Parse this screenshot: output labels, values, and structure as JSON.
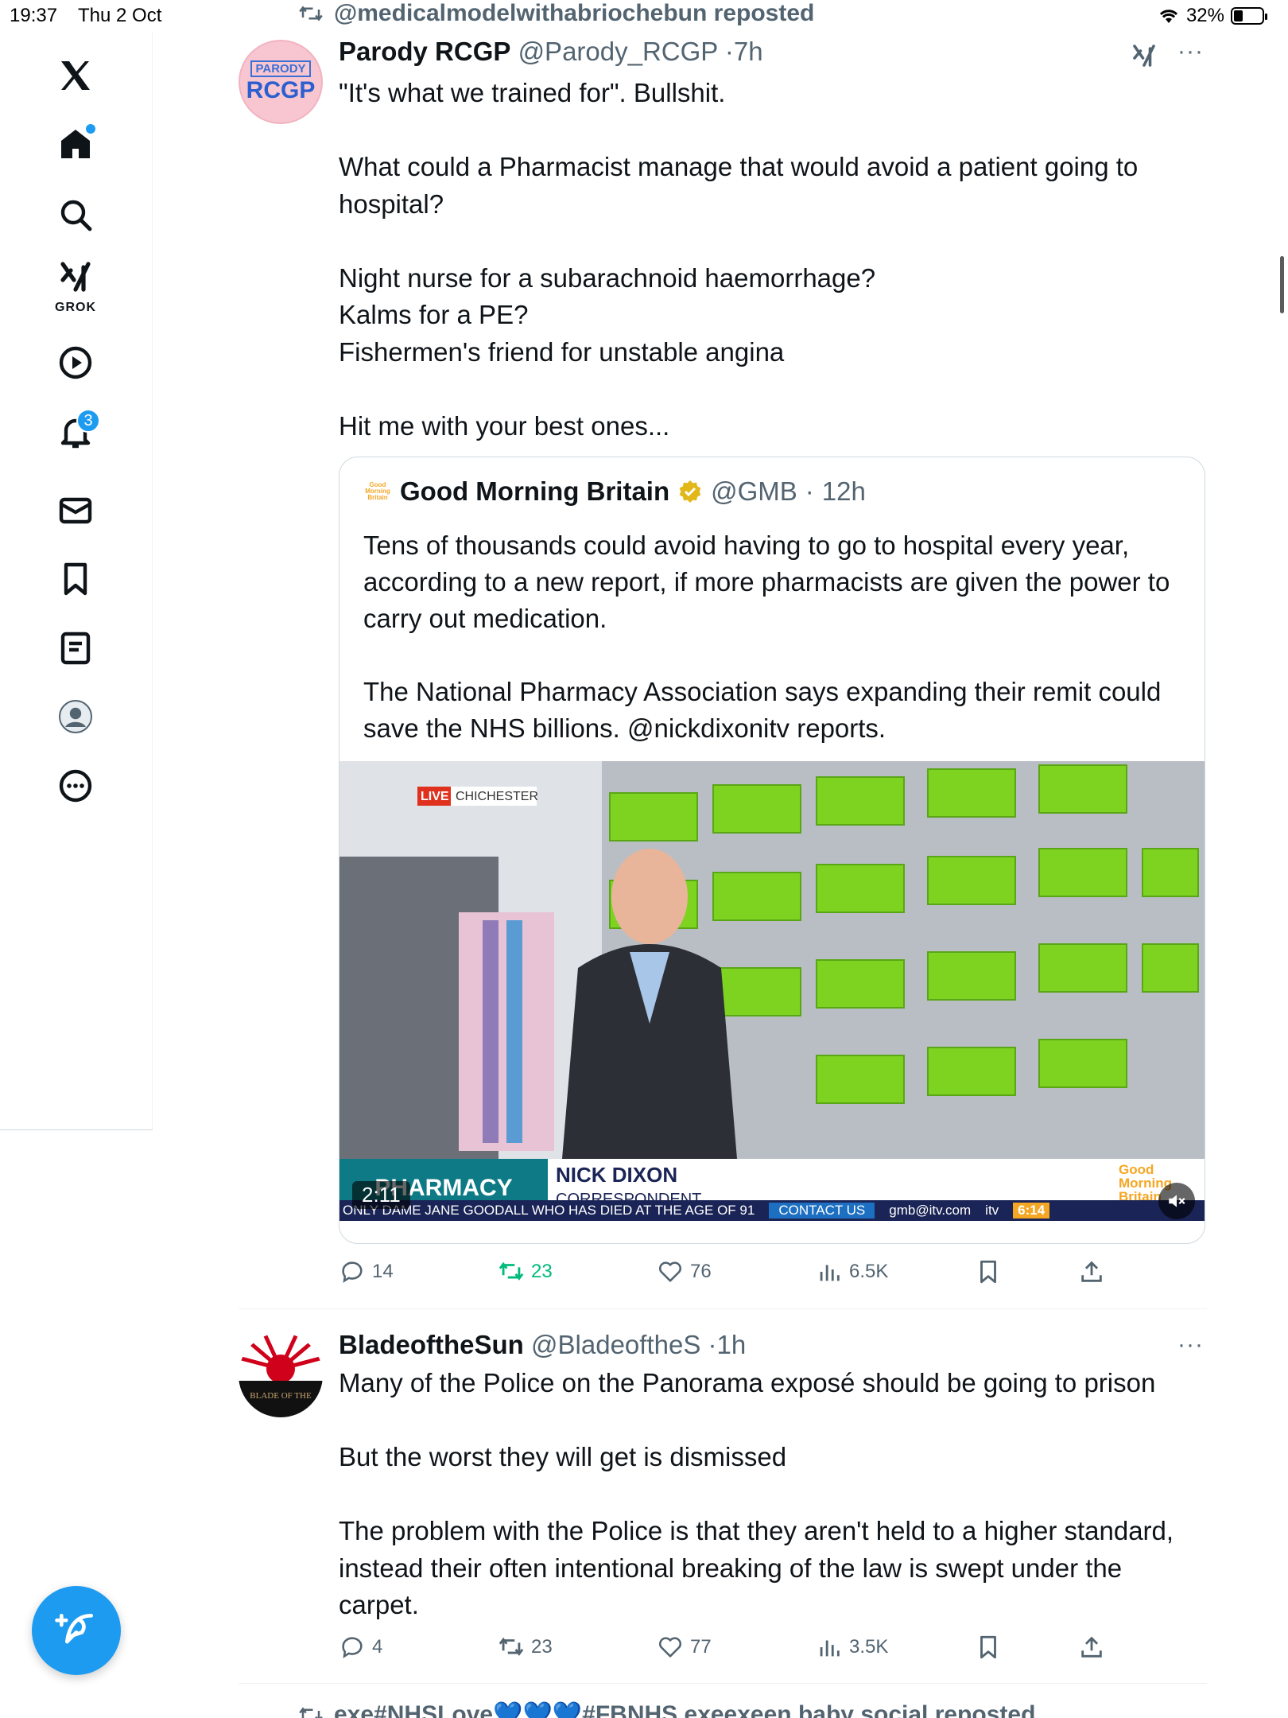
{
  "status_bar": {
    "time": "19:37",
    "date": "Thu 2 Oct",
    "battery": "32%",
    "battery_level": 0.32
  },
  "sidebar": {
    "items": [
      {
        "icon": "x-logo-icon"
      },
      {
        "icon": "home-icon",
        "has_dot": true
      },
      {
        "icon": "search-icon"
      },
      {
        "icon": "grok-icon",
        "label": "GROK"
      },
      {
        "icon": "video-play-icon"
      },
      {
        "icon": "bell-icon",
        "badge": "3"
      },
      {
        "icon": "mail-icon"
      },
      {
        "icon": "bookmark-icon"
      },
      {
        "icon": "lists-icon"
      },
      {
        "icon": "profile-avatar-icon"
      },
      {
        "icon": "more-circle-icon"
      }
    ],
    "compose_icon": "compose-feather-icon"
  },
  "posts": [
    {
      "repost_by": "@medicalmodelwithabriochebun reposted",
      "author_name": "Parody RCGP",
      "author_handle": "@Parody_RCGP",
      "time": "7h",
      "avatar_top": "PARODY",
      "avatar_main": "RCGP",
      "paragraphs": [
        "\"It's what we trained for\". Bullshit.",
        "",
        "What could a Pharmacist manage that would avoid a patient going to hospital?",
        "",
        "Night nurse for a subarachnoid haemorrhage?",
        "Kalms for a PE?",
        "Fishermen's friend for unstable angina",
        "",
        "Hit me with your best ones..."
      ],
      "quote": {
        "logo_text": "Good Morning Britain",
        "author_name": "Good Morning Britain",
        "author_handle": "@GMB",
        "time": "12h",
        "paragraphs": [
          "Tens of thousands could avoid having to go to hospital every year, according to a new report, if more pharmacists are given the power to carry out medication.",
          "",
          "The National Pharmacy Association says expanding their remit could save the NHS billions.   @nickdixonitv reports."
        ],
        "video": {
          "live_tag": "LIVE",
          "location": "CHICHESTER",
          "lower_third_left": "PHARMACY SERVICES",
          "presenter_name": "NICK DIXON",
          "presenter_role": "CORRESPONDENT",
          "brand": "Good Morning Britain",
          "ticker": "ONLY DAME JANE GOODALL WHO HAS DIED AT THE AGE OF 91",
          "contact": "CONTACT US",
          "email": "gmb@itv.com",
          "itv": "itv",
          "clock": "6:14",
          "duration": "2:11",
          "mute_icon": "speaker-muted-icon"
        }
      },
      "stats": {
        "replies": "14",
        "reposts": "23",
        "likes": "76",
        "views": "6.5K"
      }
    },
    {
      "author_name": "BladeoftheSun",
      "author_handle": "@BladeoftheS",
      "time": "1h",
      "avatar_text": "BLADE OF THE",
      "paragraphs": [
        "Many of the Police on the Panorama exposé should be going to prison",
        "",
        "But the worst they will get is dismissed",
        "",
        "The problem with the Police is that they aren't held to a higher standard, instead their often intentional breaking of the law is swept under the carpet."
      ],
      "stats": {
        "replies": "4",
        "reposts": "23",
        "likes": "77",
        "views": "3.5K"
      }
    }
  ],
  "next_repost_by": "exe#NHSLove💙💙💙#FBNHS exeexeen baby social reposted",
  "colors": {
    "accent": "#1d9bf0",
    "repost_green": "#00ba7c",
    "muted": "#536471",
    "gmb_orange": "#f5a623",
    "itv_teal": "#0d7a86"
  }
}
